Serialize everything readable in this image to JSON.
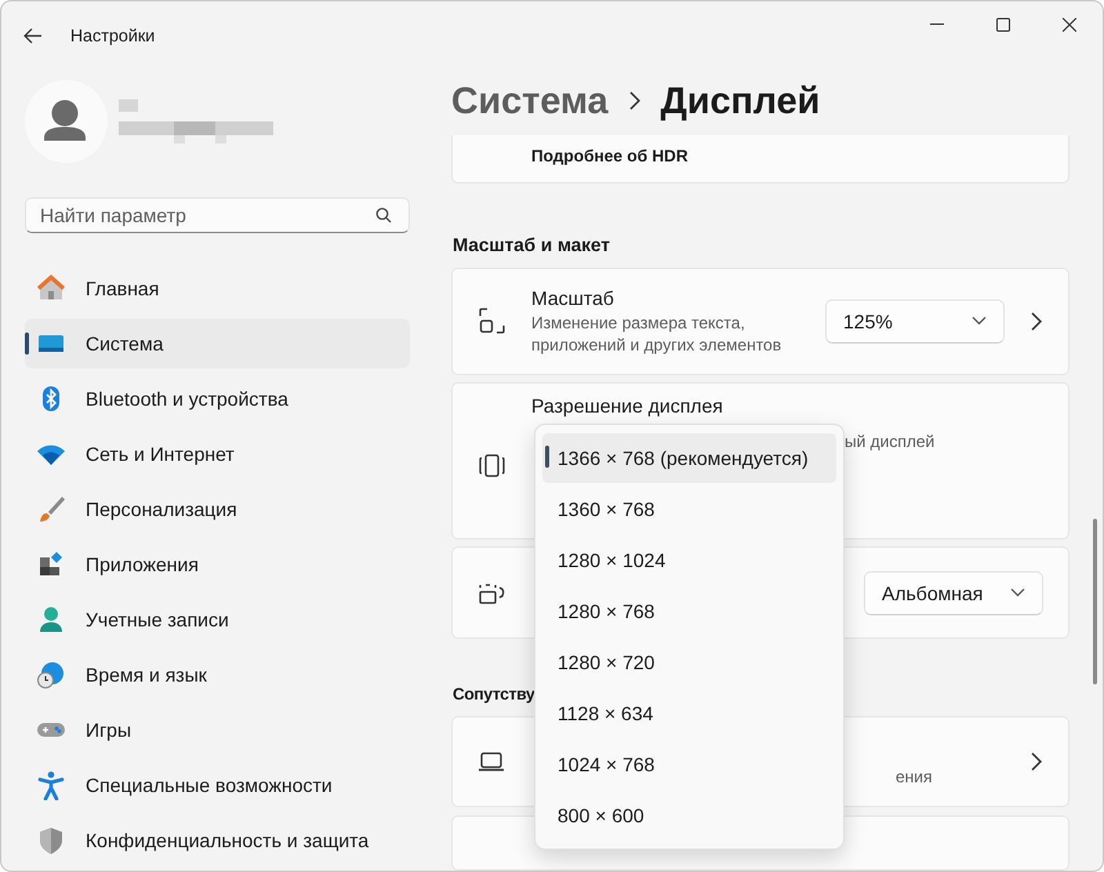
{
  "window": {
    "title": "Настройки"
  },
  "search": {
    "placeholder": "Найти параметр"
  },
  "nav": [
    {
      "label": "Главная",
      "selected": false
    },
    {
      "label": "Система",
      "selected": true
    },
    {
      "label": "Bluetooth и устройства",
      "selected": false
    },
    {
      "label": "Сеть и Интернет",
      "selected": false
    },
    {
      "label": "Персонализация",
      "selected": false
    },
    {
      "label": "Приложения",
      "selected": false
    },
    {
      "label": "Учетные записи",
      "selected": false
    },
    {
      "label": "Время и язык",
      "selected": false
    },
    {
      "label": "Игры",
      "selected": false
    },
    {
      "label": "Специальные возможности",
      "selected": false
    },
    {
      "label": "Конфиденциальность и защита",
      "selected": false
    }
  ],
  "breadcrumb": [
    "Система",
    "Дисплей"
  ],
  "hdr_card": {
    "link": "Подробнее об HDR"
  },
  "scale_section": {
    "title": "Масштаб и макет"
  },
  "scale_row": {
    "title": "Масштаб",
    "description": "Изменение размера текста, приложений и других элементов",
    "value": "125%"
  },
  "resolution_row": {
    "title": "Разрешение дисплея",
    "description_visible": "ый дисплей"
  },
  "orientation_row": {
    "value": "Альбомная"
  },
  "related_section": {
    "title_visible": "Сопутству"
  },
  "related_row": {
    "description_visible": "ения"
  },
  "resolution_menu": [
    {
      "label": "1366 × 768 (рекомендуется)",
      "selected": true
    },
    {
      "label": "1360 × 768",
      "selected": false
    },
    {
      "label": "1280 × 1024",
      "selected": false
    },
    {
      "label": "1280 × 768",
      "selected": false
    },
    {
      "label": "1280 × 720",
      "selected": false
    },
    {
      "label": "1128 × 634",
      "selected": false
    },
    {
      "label": "1024 × 768",
      "selected": false
    },
    {
      "label": "800 × 600",
      "selected": false
    }
  ]
}
